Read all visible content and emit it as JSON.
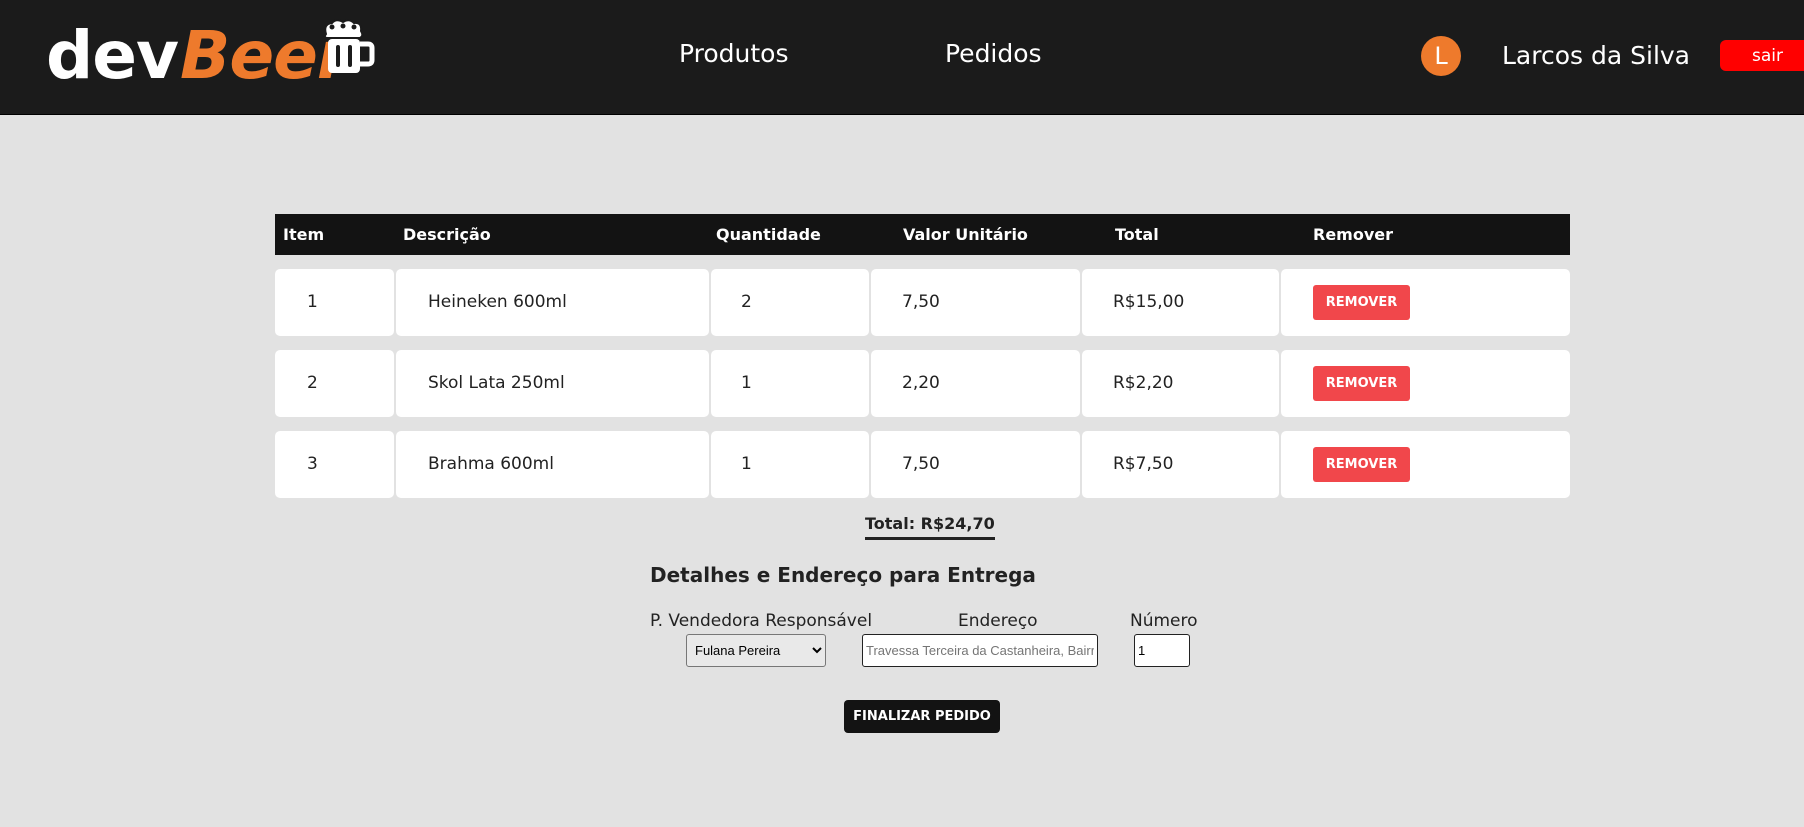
{
  "header": {
    "logo_dev": "dev",
    "logo_beer": "Beer",
    "nav": {
      "produtos": "Produtos",
      "pedidos": "Pedidos"
    },
    "user": {
      "initial": "L",
      "name": "Larcos da Silva"
    },
    "logout_label": "sair"
  },
  "table": {
    "headers": [
      "Item",
      "Descrição",
      "Quantidade",
      "Valor Unitário",
      "Total",
      "Remover"
    ],
    "rows": [
      {
        "item": "1",
        "description": "Heineken 600ml",
        "quantity": "2",
        "unit_price": "7,50",
        "total": "R$15,00",
        "remove_label": "REMOVER"
      },
      {
        "item": "2",
        "description": "Skol Lata 250ml",
        "quantity": "1",
        "unit_price": "2,20",
        "total": "R$2,20",
        "remove_label": "REMOVER"
      },
      {
        "item": "3",
        "description": "Brahma 600ml",
        "quantity": "1",
        "unit_price": "7,50",
        "total": "R$7,50",
        "remove_label": "REMOVER"
      }
    ]
  },
  "order_total": "Total: R$24,70",
  "delivery": {
    "title": "Detalhes e Endereço para Entrega",
    "seller_label": "P. Vendedora Responsável",
    "seller_selected": "Fulana Pereira",
    "address_label": "Endereço",
    "address_placeholder": "Travessa Terceira da Castanheira, Bairro Murici",
    "number_label": "Número",
    "number_value": "1",
    "finish_label": "FINALIZAR PEDIDO"
  },
  "colors": {
    "header_bg": "#1b1b1b",
    "brand_orange": "#ee7a2c",
    "remove_red": "#f1474b",
    "logout_red": "#ff0000",
    "page_bg": "#e2e2e2"
  }
}
